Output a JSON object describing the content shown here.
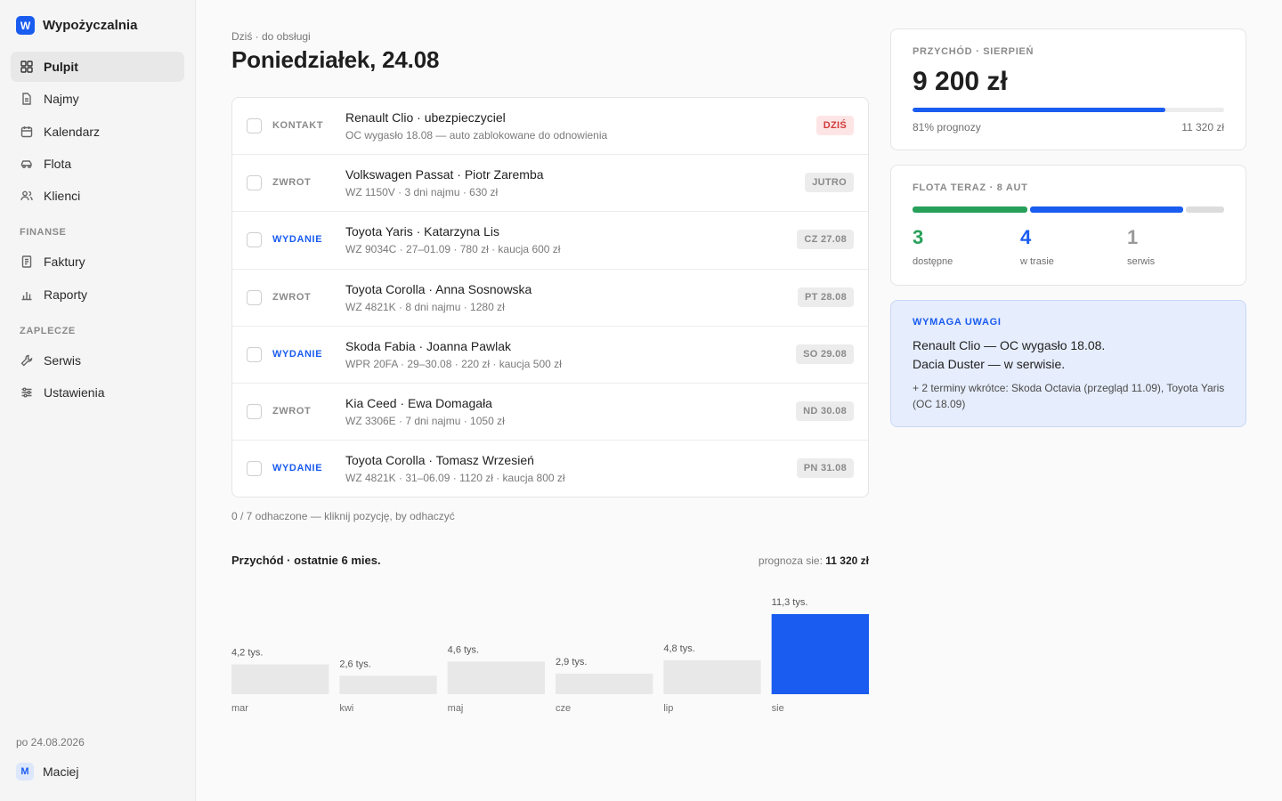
{
  "app": {
    "logo_letter": "W",
    "name": "Wypożyczalnia"
  },
  "sidebar": {
    "items": [
      {
        "label": "Pulpit",
        "icon": "grid-icon",
        "active": true
      },
      {
        "label": "Najmy",
        "icon": "document-icon"
      },
      {
        "label": "Kalendarz",
        "icon": "calendar-icon"
      },
      {
        "label": "Flota",
        "icon": "car-icon"
      },
      {
        "label": "Klienci",
        "icon": "users-icon"
      }
    ],
    "finance_label": "FINANSE",
    "finance_items": [
      {
        "label": "Faktury",
        "icon": "invoice-icon"
      },
      {
        "label": "Raporty",
        "icon": "bar-chart-icon"
      }
    ],
    "backoffice_label": "ZAPLECZE",
    "backoffice_items": [
      {
        "label": "Serwis",
        "icon": "wrench-icon"
      },
      {
        "label": "Ustawienia",
        "icon": "sliders-icon"
      }
    ],
    "date": "po 24.08.2026",
    "user": {
      "initial": "M",
      "name": "Maciej"
    }
  },
  "header": {
    "subtitle": "Dziś · do obsługi",
    "title": "Poniedziałek, 24.08"
  },
  "tasks": [
    {
      "type": "KONTAKT",
      "type_color": "gray",
      "title": "Renault Clio · ubezpieczyciel",
      "sub": "OC wygasło 18.08 — auto zablokowane do odnowienia",
      "badge": "DZIŚ",
      "badge_color": "red"
    },
    {
      "type": "ZWROT",
      "type_color": "gray",
      "title": "Volkswagen Passat · Piotr Zaremba",
      "sub": "WZ 1150V · 3 dni najmu · 630 zł",
      "badge": "JUTRO",
      "badge_color": "gray"
    },
    {
      "type": "WYDANIE",
      "type_color": "blue",
      "title": "Toyota Yaris · Katarzyna Lis",
      "sub": "WZ 9034C · 27–01.09 · 780 zł · kaucja 600 zł",
      "badge": "CZ 27.08",
      "badge_color": "gray"
    },
    {
      "type": "ZWROT",
      "type_color": "gray",
      "title": "Toyota Corolla · Anna Sosnowska",
      "sub": "WZ 4821K · 8 dni najmu · 1280 zł",
      "badge": "PT 28.08",
      "badge_color": "gray"
    },
    {
      "type": "WYDANIE",
      "type_color": "blue",
      "title": "Skoda Fabia · Joanna Pawlak",
      "sub": "WPR 20FA · 29–30.08 · 220 zł · kaucja 500 zł",
      "badge": "SO 29.08",
      "badge_color": "gray"
    },
    {
      "type": "ZWROT",
      "type_color": "gray",
      "title": "Kia Ceed · Ewa Domagała",
      "sub": "WZ 3306E · 7 dni najmu · 1050 zł",
      "badge": "ND 30.08",
      "badge_color": "gray"
    },
    {
      "type": "WYDANIE",
      "type_color": "blue",
      "title": "Toyota Corolla · Tomasz Wrzesień",
      "sub": "WZ 4821K · 31–06.09 · 1120 zł · kaucja 800 zł",
      "badge": "PN 31.08",
      "badge_color": "gray"
    }
  ],
  "progress_note": "0 / 7 odhaczone — kliknij pozycję, by odhaczyć",
  "chart_header": {
    "title": "Przychód · ostatnie 6 mies.",
    "forecast_label": "prognoza sie:",
    "forecast_value": "11 320 zł"
  },
  "chart_data": {
    "type": "bar",
    "title": "Przychód · ostatnie 6 mies.",
    "categories": [
      "mar",
      "kwi",
      "maj",
      "cze",
      "lip",
      "sie"
    ],
    "values": [
      4.2,
      2.6,
      4.6,
      2.9,
      4.8,
      11.3
    ],
    "value_labels": [
      "4,2 tys.",
      "2,6 tys.",
      "4,6 tys.",
      "2,9 tys.",
      "4,8 tys.",
      "11,3 tys."
    ],
    "highlight_index": 5,
    "ylim": [
      0,
      11.3
    ],
    "xlabel": "",
    "ylabel": "",
    "grid": false,
    "colors": {
      "default": "#e8e8e8",
      "highlight": "#1a5cf0"
    }
  },
  "revenue_card": {
    "label": "PRZYCHÓD · SIERPIEŃ",
    "amount": "9 200 zł",
    "progress": 0.81,
    "progress_label": "81% prognozy",
    "target": "11 320 zł"
  },
  "fleet_card": {
    "label": "FLOTA TERAZ · 8 AUT",
    "stats": [
      {
        "value": "3",
        "caption": "dostępne",
        "count": 3,
        "color": "#27a05a"
      },
      {
        "value": "4",
        "caption": "w trasie",
        "count": 4,
        "color": "#1a5cf0"
      },
      {
        "value": "1",
        "caption": "serwis",
        "count": 1,
        "color": "#9a9a9a"
      }
    ]
  },
  "alert_card": {
    "label": "WYMAGA UWAGI",
    "line1": "Renault Clio — OC wygasło 18.08.",
    "line2": "Dacia Duster — w serwisie.",
    "more": "+ 2 terminy wkrótce: Skoda Octavia (przegląd 11.09), Toyota Yaris (OC 18.09)"
  },
  "colors": {
    "accent": "#1a5cf0",
    "danger": "#d23a3a",
    "success": "#27a05a"
  }
}
